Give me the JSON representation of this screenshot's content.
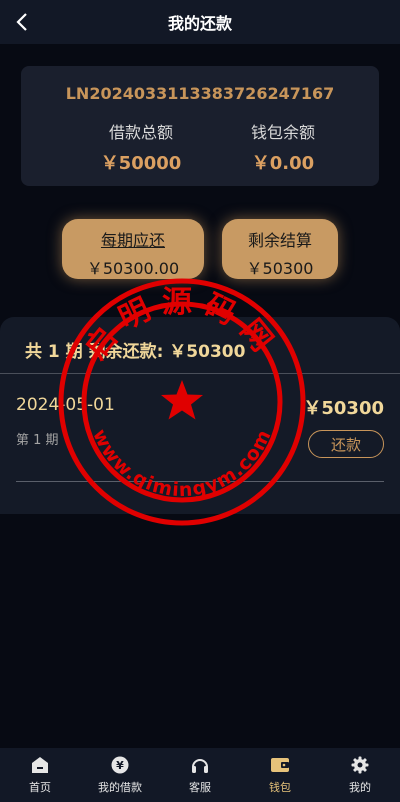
{
  "header": {
    "title": "我的还款"
  },
  "loan": {
    "number": "LN2024033113383726247167",
    "total_label": "借款总额",
    "total_value": "￥50000",
    "wallet_label": "钱包余额",
    "wallet_value": "￥0.00"
  },
  "pills": {
    "period": {
      "label": "每期应还",
      "value": "￥50300.00"
    },
    "remaining": {
      "label": "剩余结算",
      "value": "￥50300"
    }
  },
  "summary": {
    "text": "共 1 期  剩余还款: ￥50300"
  },
  "installments": [
    {
      "date": "2024-05-01",
      "amount": "￥50300",
      "period": "第 1 期",
      "action": "还款"
    }
  ],
  "watermark": {
    "text": "启明源码网",
    "url": "www.qimingym.com",
    "color": "#e00000"
  },
  "tabbar": {
    "items": [
      {
        "label": "首页",
        "icon": "home-icon"
      },
      {
        "label": "我的借款",
        "icon": "yen-coin-icon"
      },
      {
        "label": "客服",
        "icon": "headset-icon"
      },
      {
        "label": "钱包",
        "icon": "wallet-icon",
        "active": true
      },
      {
        "label": "我的",
        "icon": "gear-icon"
      }
    ]
  },
  "colors": {
    "accent": "#c89a63",
    "gold_text": "#f0d79a",
    "active_tab": "#e6c27a"
  }
}
